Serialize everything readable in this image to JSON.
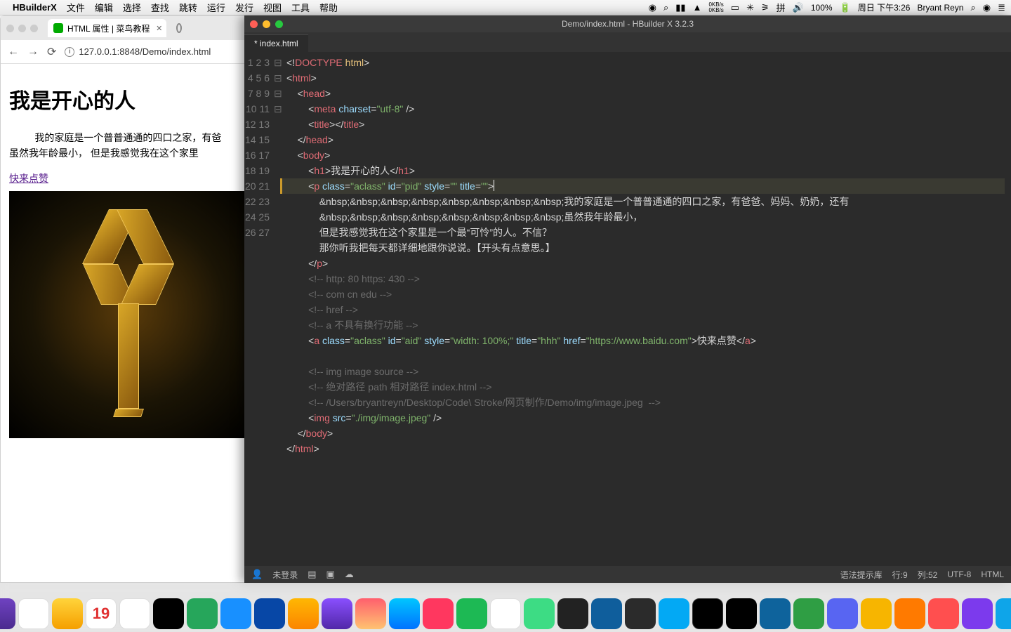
{
  "menubar": {
    "app": "HBuilderX",
    "items": [
      "文件",
      "编辑",
      "选择",
      "查找",
      "跳转",
      "运行",
      "发行",
      "视图",
      "工具",
      "帮助"
    ],
    "net_up": "0KB/s",
    "net_dn": "0KB/s",
    "battery": "100%",
    "clock": "周日 下午3:26",
    "user": "Bryant Reyn"
  },
  "browser": {
    "tab1": "HTML 属性 | 菜鸟教程",
    "url": "127.0.0.1:8848/Demo/index.html",
    "h1": "我是开心的人",
    "p1": "我的家庭是一个普普通通的四口之家，有爸",
    "p2": "虽然我年龄最小，  但是我感觉我在这个家里",
    "link": "快来点赞"
  },
  "editor": {
    "title": "Demo/index.html - HBuilder X 3.2.3",
    "tab": "* index.html",
    "lines": [
      "1",
      "2",
      "3",
      "4",
      "5",
      "6",
      "7",
      "8",
      "9",
      "10",
      "11",
      "12",
      "13",
      "14",
      "15",
      "16",
      "17",
      "18",
      "19",
      "20",
      "21",
      "22",
      "23",
      "24",
      "25",
      "26",
      "27"
    ],
    "fold": [
      "",
      "⊟",
      "⊟",
      "",
      "",
      "",
      "",
      "⊟",
      "⊟",
      "",
      "",
      "",
      "",
      "",
      "",
      "",
      "",
      "",
      "",
      "",
      "",
      "",
      "",
      "",
      "",
      "",
      ""
    ],
    "code": {
      "l1a": "<!",
      "l1b": "DOCTYPE",
      "l1c": " html",
      "l1d": ">",
      "l2a": "<",
      "l2b": "html",
      "l2c": ">",
      "l3a": "<",
      "l3b": "head",
      "l3c": ">",
      "l4a": "<",
      "l4b": "meta",
      "l4c": " charset",
      "l4d": "=",
      "l4e": "\"utf-8\"",
      "l4f": " />",
      "l5a": "<",
      "l5b": "title",
      "l5c": "></",
      "l5d": "title",
      "l5e": ">",
      "l6a": "</",
      "l6b": "head",
      "l6c": ">",
      "l7a": "<",
      "l7b": "body",
      "l7c": ">",
      "l8a": "<",
      "l8b": "h1",
      "l8c": ">",
      "l8d": "我是开心的人",
      "l8e": "</",
      "l8f": "h1",
      "l8g": ">",
      "l9a": "<",
      "l9b": "p",
      "l9c": " class",
      "l9d": "=",
      "l9e": "\"aclass\"",
      "l9f": " id",
      "l9g": "=",
      "l9h": "\"pid\"",
      "l9i": " style",
      "l9j": "=",
      "l9k": "\"\"",
      "l9l": " title",
      "l9m": "=",
      "l9n": "\"\"",
      "l9o": ">",
      "l10": "&nbsp;&nbsp;&nbsp;&nbsp;&nbsp;&nbsp;&nbsp;&nbsp;我的家庭是一个普普通通的四口之家，有爸爸、妈妈、奶奶，还有",
      "l11": "&nbsp;&nbsp;&nbsp;&nbsp;&nbsp;&nbsp;&nbsp;&nbsp;虽然我年龄最小，",
      "l12": "但是我感觉我在这个家里是一个最“可怜”的人。不信？",
      "l13": "那你听我把每天都详细地跟你说说。【开头有点意思。】",
      "l14a": "</",
      "l14b": "p",
      "l14c": ">",
      "l15": "<!-- http: 80 https: 430 -->",
      "l16": "<!-- com cn edu -->",
      "l17": "<!-- href -->",
      "l18": "<!-- a 不具有换行功能 -->",
      "l19a": "<",
      "l19b": "a",
      "l19c": " class",
      "l19d": "=",
      "l19e": "\"aclass\"",
      "l19f": " id",
      "l19g": "=",
      "l19h": "\"aid\"",
      "l19i": " style",
      "l19j": "=",
      "l19k": "\"width: 100%;\"",
      "l19l": " title",
      "l19m": "=",
      "l19n": "\"hhh\"",
      "l19o": " href",
      "l19p": "=",
      "l19q": "\"https://www.baidu.com\"",
      "l19r": ">",
      "l19s": "快来点赞",
      "l19t": "</",
      "l19u": "a",
      "l19v": ">",
      "l21": "<!-- img image source -->",
      "l22": "<!-- 绝对路径 path 相对路径 index.html -->",
      "l23": "<!-- /Users/bryantreyn/Desktop/Code\\ Stroke/网页制作/Demo/img/image.jpeg  -->",
      "l24a": "<",
      "l24b": "img",
      "l24c": " src",
      "l24d": "=",
      "l24e": "\"./img/image.jpeg\"",
      "l24f": " />",
      "l25a": "</",
      "l25b": "body",
      "l25c": ">",
      "l26a": "</",
      "l26b": "html",
      "l26c": ">"
    },
    "status": {
      "login": "未登录",
      "syntax": "语法提示库",
      "line": "行:9",
      "col": "列:52",
      "enc": "UTF-8",
      "lang": "HTML"
    }
  },
  "dock": {
    "items": [
      "finder",
      "activity",
      "safari",
      "music",
      "firefox",
      "chrome",
      "calendar",
      "preview",
      "photos",
      "messages",
      "wechat",
      "qq",
      "mail",
      "maps",
      "notes",
      "appstore",
      "podcasts",
      "music2",
      "xcode",
      "android",
      "terminal",
      "docker",
      "intellij",
      "vscode",
      "iterm",
      "obs",
      "pycharm",
      "wps",
      "discord",
      "folder",
      "folder2",
      "folder3",
      "app",
      "app2",
      "app3",
      "app4",
      "trash"
    ],
    "calendar_day": "19"
  }
}
